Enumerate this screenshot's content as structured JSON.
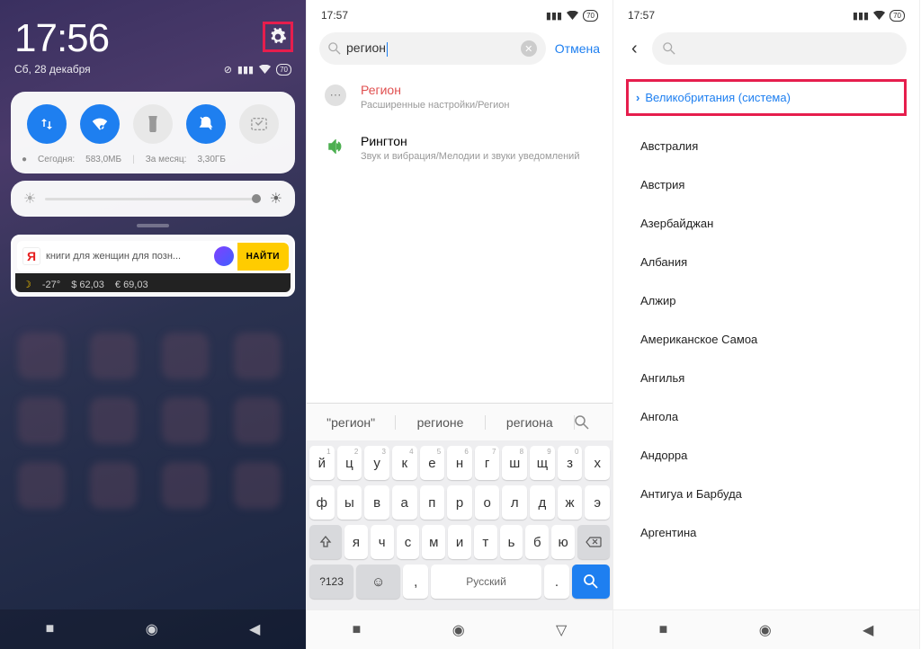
{
  "panel1": {
    "time": "17:56",
    "date": "Сб, 28 декабря",
    "battery": "70",
    "data_today_label": "Сегодня:",
    "data_today": "583,0МБ",
    "data_month_label": "За месяц:",
    "data_month": "3,30ГБ",
    "yandex_query": "книги для женщин для позн...",
    "yandex_find": "НАЙТИ",
    "temp": "-27°",
    "usd": "$ 62,03",
    "eur": "€ 69,03"
  },
  "panel2": {
    "time": "17:57",
    "battery": "70",
    "search_value": "регион",
    "cancel": "Отмена",
    "results": [
      {
        "title": "Регион",
        "sub": "Расширенные настройки/Регион"
      },
      {
        "title": "Рингтон",
        "sub": "Звук и вибрация/Мелодии и звуки уведомлений"
      }
    ],
    "suggestions": [
      "\"регион\"",
      "регионе",
      "региона"
    ],
    "kb_row1": [
      "й",
      "ц",
      "у",
      "к",
      "е",
      "н",
      "г",
      "ш",
      "щ",
      "з",
      "х"
    ],
    "kb_row2": [
      "ф",
      "ы",
      "в",
      "а",
      "п",
      "р",
      "о",
      "л",
      "д",
      "ж",
      "э"
    ],
    "kb_row3": [
      "я",
      "ч",
      "с",
      "м",
      "и",
      "т",
      "ь",
      "б",
      "ю"
    ],
    "kb_lang": "Русский",
    "kb_nums": "?123"
  },
  "panel3": {
    "time": "17:57",
    "battery": "70",
    "selected": "Великобритания (система)",
    "regions": [
      "Австралия",
      "Австрия",
      "Азербайджан",
      "Албания",
      "Алжир",
      "Американское Самоа",
      "Ангилья",
      "Ангола",
      "Андорра",
      "Антигуа и Барбуда",
      "Аргентина"
    ]
  }
}
